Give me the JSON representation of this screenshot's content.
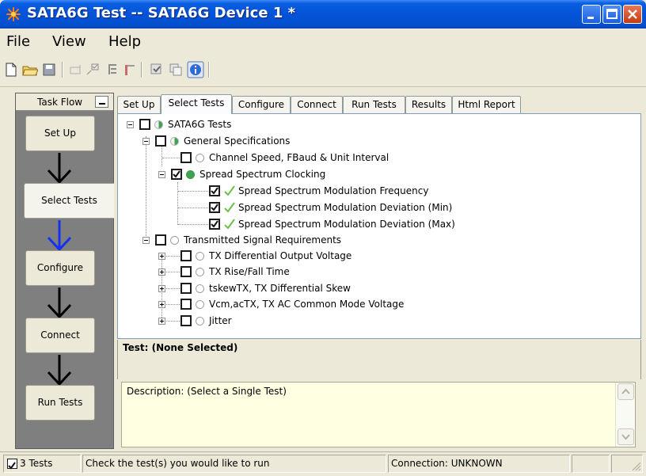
{
  "window": {
    "title": "SATA6G Test -- SATA6G Device 1 *"
  },
  "menu": {
    "file": "File",
    "view": "View",
    "help": "Help"
  },
  "toolbar": {
    "icons": [
      "new-file-icon",
      "open-folder-icon",
      "save-icon",
      "connection-icon",
      "select-tests-icon",
      "tree-icon",
      "limits-icon",
      "run-icon",
      "copy-icon",
      "info-icon"
    ]
  },
  "taskflow": {
    "title": "Task Flow",
    "steps": [
      "Set Up",
      "Select Tests",
      "Configure",
      "Connect",
      "Run Tests"
    ],
    "active_step": "Select Tests"
  },
  "tabs": [
    "Set Up",
    "Select Tests",
    "Configure",
    "Connect",
    "Run Tests",
    "Results",
    "Html Report"
  ],
  "active_tab": "Select Tests",
  "tree": {
    "root": {
      "label": "SATA6G Tests",
      "checked": false
    },
    "general": {
      "label": "General Specifications",
      "checked": false
    },
    "channel_speed": {
      "label": "Channel Speed, FBaud & Unit Interval",
      "checked": false
    },
    "ssc": {
      "label": "Spread Spectrum Clocking",
      "checked": true
    },
    "ssc_freq": {
      "label": "Spread Spectrum Modulation Frequency",
      "checked": true
    },
    "ssc_dev_min": {
      "label": "Spread Spectrum Modulation Deviation (Min)",
      "checked": true
    },
    "ssc_dev_max": {
      "label": "Spread Spectrum Modulation Deviation (Max)",
      "checked": true
    },
    "tx_req": {
      "label": "Transmitted Signal Requirements",
      "checked": false
    },
    "tx_diff_out": {
      "label": "TX Differential Output Voltage",
      "checked": false
    },
    "tx_rise_fall": {
      "label": "TX Rise/Fall Time",
      "checked": false
    },
    "tskew": {
      "label": "tskewTX, TX Differential Skew",
      "checked": false
    },
    "vcm": {
      "label": "Vcm,acTX, TX AC Common Mode Voltage",
      "checked": false
    },
    "jitter": {
      "label": "Jitter",
      "checked": false
    }
  },
  "test_panel": {
    "header": "Test: (None Selected)",
    "description": "Description: (Select a Single Test)"
  },
  "status": {
    "tests_count": "3 Tests",
    "message": "Check the test(s) you would like to run",
    "connection": "Connection: UNKNOWN"
  },
  "colors": {
    "title_blue": "#0453d8",
    "pass_green": "#3ea24f",
    "flow_arrow_active": "#1430f0"
  }
}
